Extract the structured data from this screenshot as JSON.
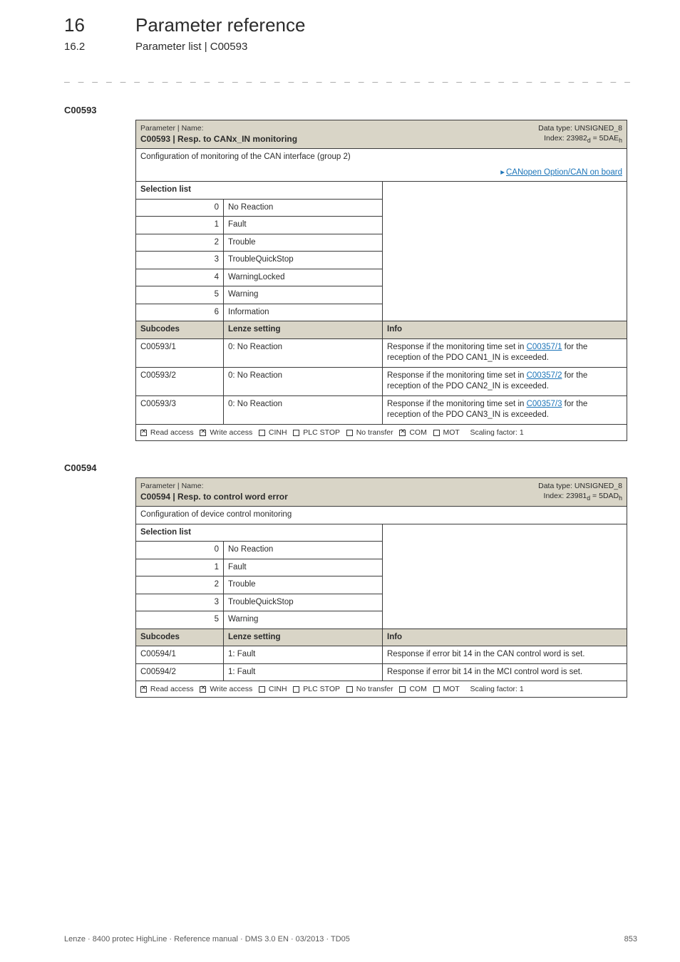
{
  "header": {
    "chapter_num": "16",
    "chapter_title": "Parameter reference",
    "section_num": "16.2",
    "section_title": "Parameter list | C00593"
  },
  "dashes": "_ _ _ _ _ _ _ _ _ _ _ _ _ _ _ _ _ _ _ _ _ _ _ _ _ _ _ _ _ _ _ _ _ _ _ _ _ _ _ _ _ _ _ _ _ _ _ _ _ _ _ _ _ _ _ _ _ _ _ _ _ _ _ _",
  "tables": [
    {
      "code": "C00593",
      "name_label": "Parameter | Name:",
      "name": "C00593 | Resp. to CANx_IN monitoring",
      "dtype_line1": "Data type: UNSIGNED_8",
      "dtype_line2": "Index: 23982d = 5DAEh",
      "config_desc": "Configuration of monitoring of the CAN interface (group 2)",
      "link_text": "CANopen Option/CAN on board",
      "selection_label": "Selection list",
      "options": [
        {
          "n": "0",
          "t": "No Reaction"
        },
        {
          "n": "1",
          "t": "Fault"
        },
        {
          "n": "2",
          "t": "Trouble"
        },
        {
          "n": "3",
          "t": "TroubleQuickStop"
        },
        {
          "n": "4",
          "t": "WarningLocked"
        },
        {
          "n": "5",
          "t": "Warning"
        },
        {
          "n": "6",
          "t": "Information"
        }
      ],
      "sub_headers": {
        "a": "Subcodes",
        "b": "Lenze setting",
        "c": "Info"
      },
      "subcodes": [
        {
          "a": "C00593/1",
          "b": "0: No Reaction",
          "info_pre": "Response if the monitoring time set in ",
          "info_link": "C00357/1",
          "info_post": " for the reception of the PDO CAN1_IN is exceeded."
        },
        {
          "a": "C00593/2",
          "b": "0: No Reaction",
          "info_pre": "Response if the monitoring time set in ",
          "info_link": "C00357/2",
          "info_post": " for the reception of the PDO CAN2_IN is exceeded."
        },
        {
          "a": "C00593/3",
          "b": "0: No Reaction",
          "info_pre": "Response if the monitoring time set in ",
          "info_link": "C00357/3",
          "info_post": " for the reception of the PDO CAN3_IN is exceeded."
        }
      ],
      "access": {
        "read": "Read access",
        "write": "Write access",
        "cinh": "CINH",
        "plc": "PLC STOP",
        "notrans": "No transfer",
        "com": "COM",
        "mot": "MOT",
        "scaling": "Scaling factor: 1",
        "checked": {
          "read": true,
          "write": true,
          "cinh": false,
          "plc": false,
          "notrans": false,
          "com": true,
          "mot": false
        }
      }
    },
    {
      "code": "C00594",
      "name_label": "Parameter | Name:",
      "name": "C00594 | Resp. to control word error",
      "dtype_line1": "Data type: UNSIGNED_8",
      "dtype_line2": "Index: 23981d = 5DADh",
      "config_desc": "Configuration of device control monitoring",
      "selection_label": "Selection list",
      "options": [
        {
          "n": "0",
          "t": "No Reaction"
        },
        {
          "n": "1",
          "t": "Fault"
        },
        {
          "n": "2",
          "t": "Trouble"
        },
        {
          "n": "3",
          "t": "TroubleQuickStop"
        },
        {
          "n": "5",
          "t": "Warning"
        }
      ],
      "sub_headers": {
        "a": "Subcodes",
        "b": "Lenze setting",
        "c": "Info"
      },
      "subcodes": [
        {
          "a": "C00594/1",
          "b": "1: Fault",
          "info": "Response if error bit 14 in the CAN control word is set."
        },
        {
          "a": "C00594/2",
          "b": "1: Fault",
          "info": "Response if error bit 14 in the MCI control word is set."
        }
      ],
      "access": {
        "read": "Read access",
        "write": "Write access",
        "cinh": "CINH",
        "plc": "PLC STOP",
        "notrans": "No transfer",
        "com": "COM",
        "mot": "MOT",
        "scaling": "Scaling factor: 1",
        "checked": {
          "read": true,
          "write": true,
          "cinh": false,
          "plc": false,
          "notrans": false,
          "com": false,
          "mot": false
        }
      }
    }
  ],
  "footer": {
    "left": "Lenze · 8400 protec HighLine · Reference manual · DMS 3.0 EN · 03/2013 · TD05",
    "right": "853"
  }
}
